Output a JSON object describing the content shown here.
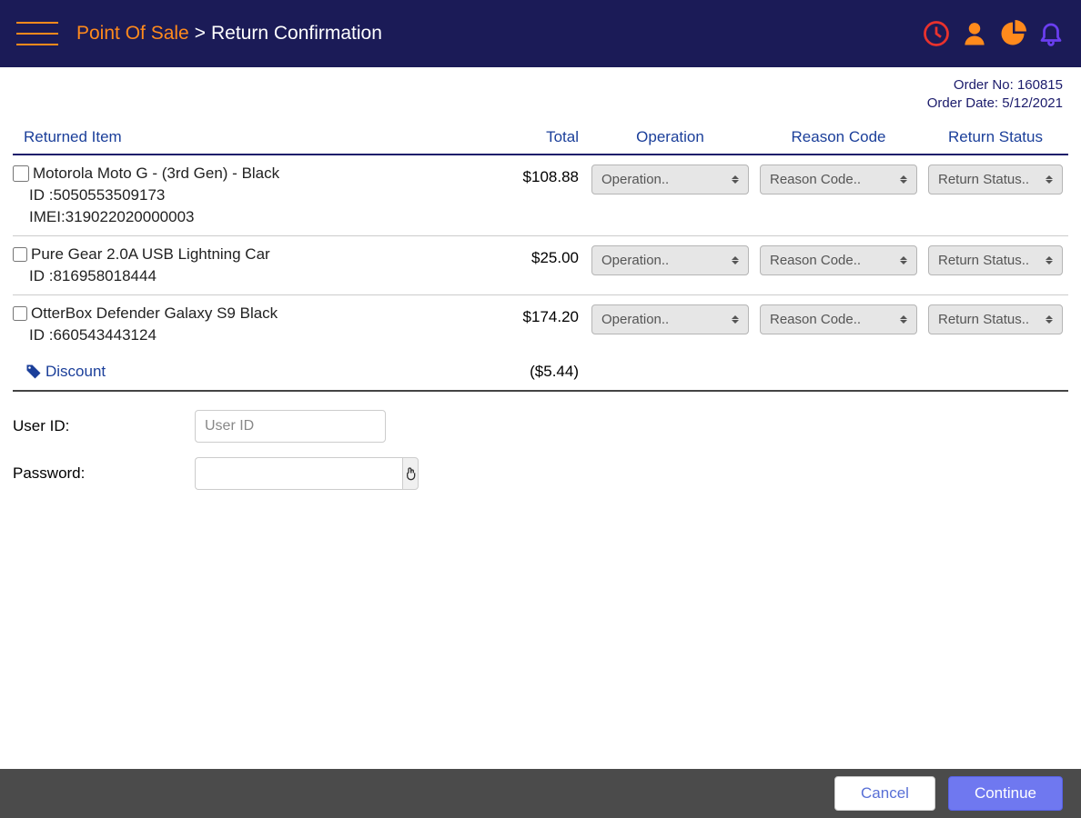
{
  "breadcrumb": {
    "root": "Point Of Sale",
    "sep": ">",
    "page": "Return Confirmation"
  },
  "order": {
    "number_label": "Order No: ",
    "number": "160815",
    "date_label": "Order Date: ",
    "date": "5/12/2021"
  },
  "table": {
    "headers": {
      "item": "Returned Item",
      "total": "Total",
      "operation": "Operation",
      "reason": "Reason Code",
      "status": "Return Status"
    },
    "dropdown_labels": {
      "operation": "Operation..",
      "reason": "Reason Code..",
      "status": "Return Status.."
    },
    "rows": [
      {
        "name": "Motorola Moto G - (3rd Gen) - Black",
        "id_label": "ID :",
        "id": "5050553509173",
        "imei_label": "IMEI:",
        "imei": "319022020000003",
        "total": "$108.88"
      },
      {
        "name": "Pure Gear 2.0A USB Lightning Car",
        "id_label": "ID :",
        "id": "816958018444",
        "total": "$25.00"
      },
      {
        "name": "OtterBox Defender Galaxy S9 Black",
        "id_label": "ID :",
        "id": "660543443124",
        "total": "$174.20"
      }
    ],
    "discount": {
      "label": "Discount",
      "amount": "($5.44)"
    }
  },
  "credentials": {
    "user_label": "User ID:",
    "user_placeholder": "User ID",
    "password_label": "Password:"
  },
  "footer": {
    "cancel": "Cancel",
    "continue": "Continue"
  }
}
